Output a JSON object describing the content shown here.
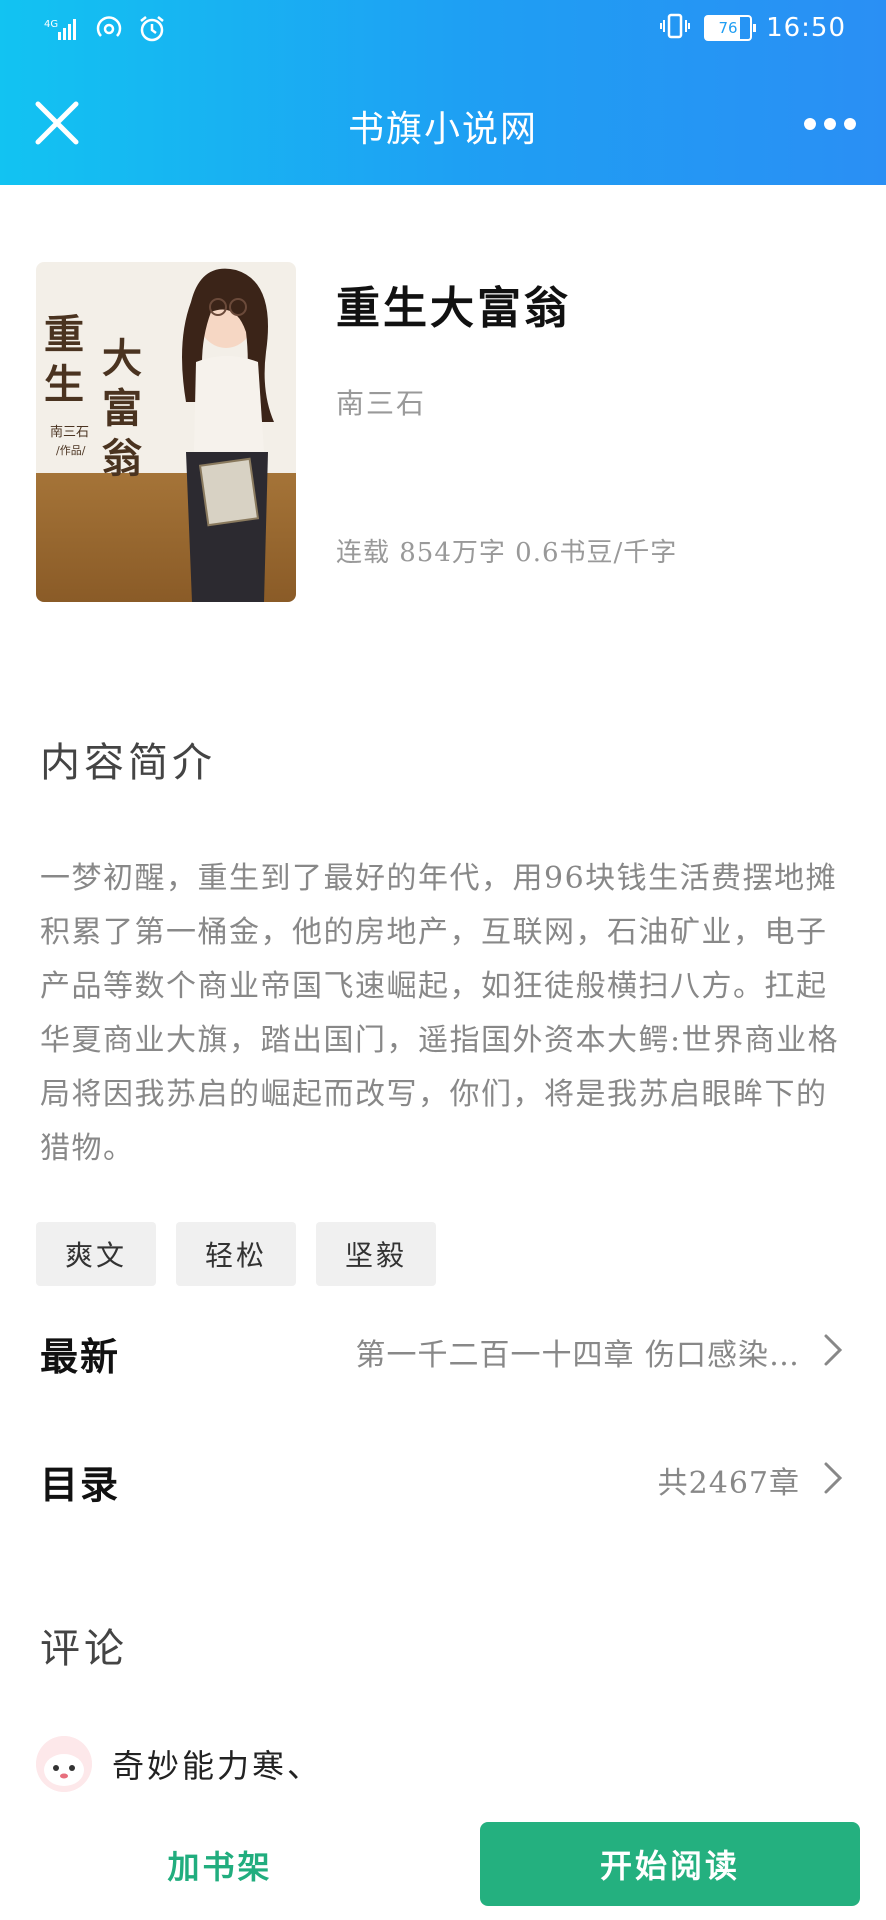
{
  "status_bar": {
    "network": "4G",
    "battery": "76",
    "time": "16:50"
  },
  "header": {
    "title": "书旗小说网",
    "close_icon": "close-icon",
    "more_icon": "more-dots-icon"
  },
  "book": {
    "title": "重生大富翁",
    "author": "南三石",
    "meta": "连载 854万字 0.6书豆/千字",
    "cover": {
      "title_chars": [
        "重",
        "生",
        "大",
        "富",
        "翁"
      ],
      "author_line": "南三石",
      "author_suffix": "/作品/"
    }
  },
  "intro": {
    "heading": "内容简介",
    "text": "一梦初醒，重生到了最好的年代，用96块钱生活费摆地摊积累了第一桶金，他的房地产，互联网，石油矿业，电子产品等数个商业帝国飞速崛起，如狂徒般横扫八方。扛起华夏商业大旗，踏出国门，遥指国外资本大鳄:世界商业格局将因我苏启的崛起而改写，你们，将是我苏启眼眸下的猎物。"
  },
  "tags": [
    "爽文",
    "轻松",
    "坚毅"
  ],
  "latest": {
    "label": "最新",
    "value": "第一千二百一十四章 伤口感染…"
  },
  "catalog": {
    "label": "目录",
    "value": "共2467章"
  },
  "comments": {
    "heading": "评论",
    "first_user": "奇妙能力寒、"
  },
  "actions": {
    "add_shelf": "加书架",
    "start_read": "开始阅读"
  },
  "colors": {
    "header_gradient_start": "#12c3f2",
    "header_gradient_end": "#2a8ff4",
    "accent_green": "#24b07f"
  }
}
